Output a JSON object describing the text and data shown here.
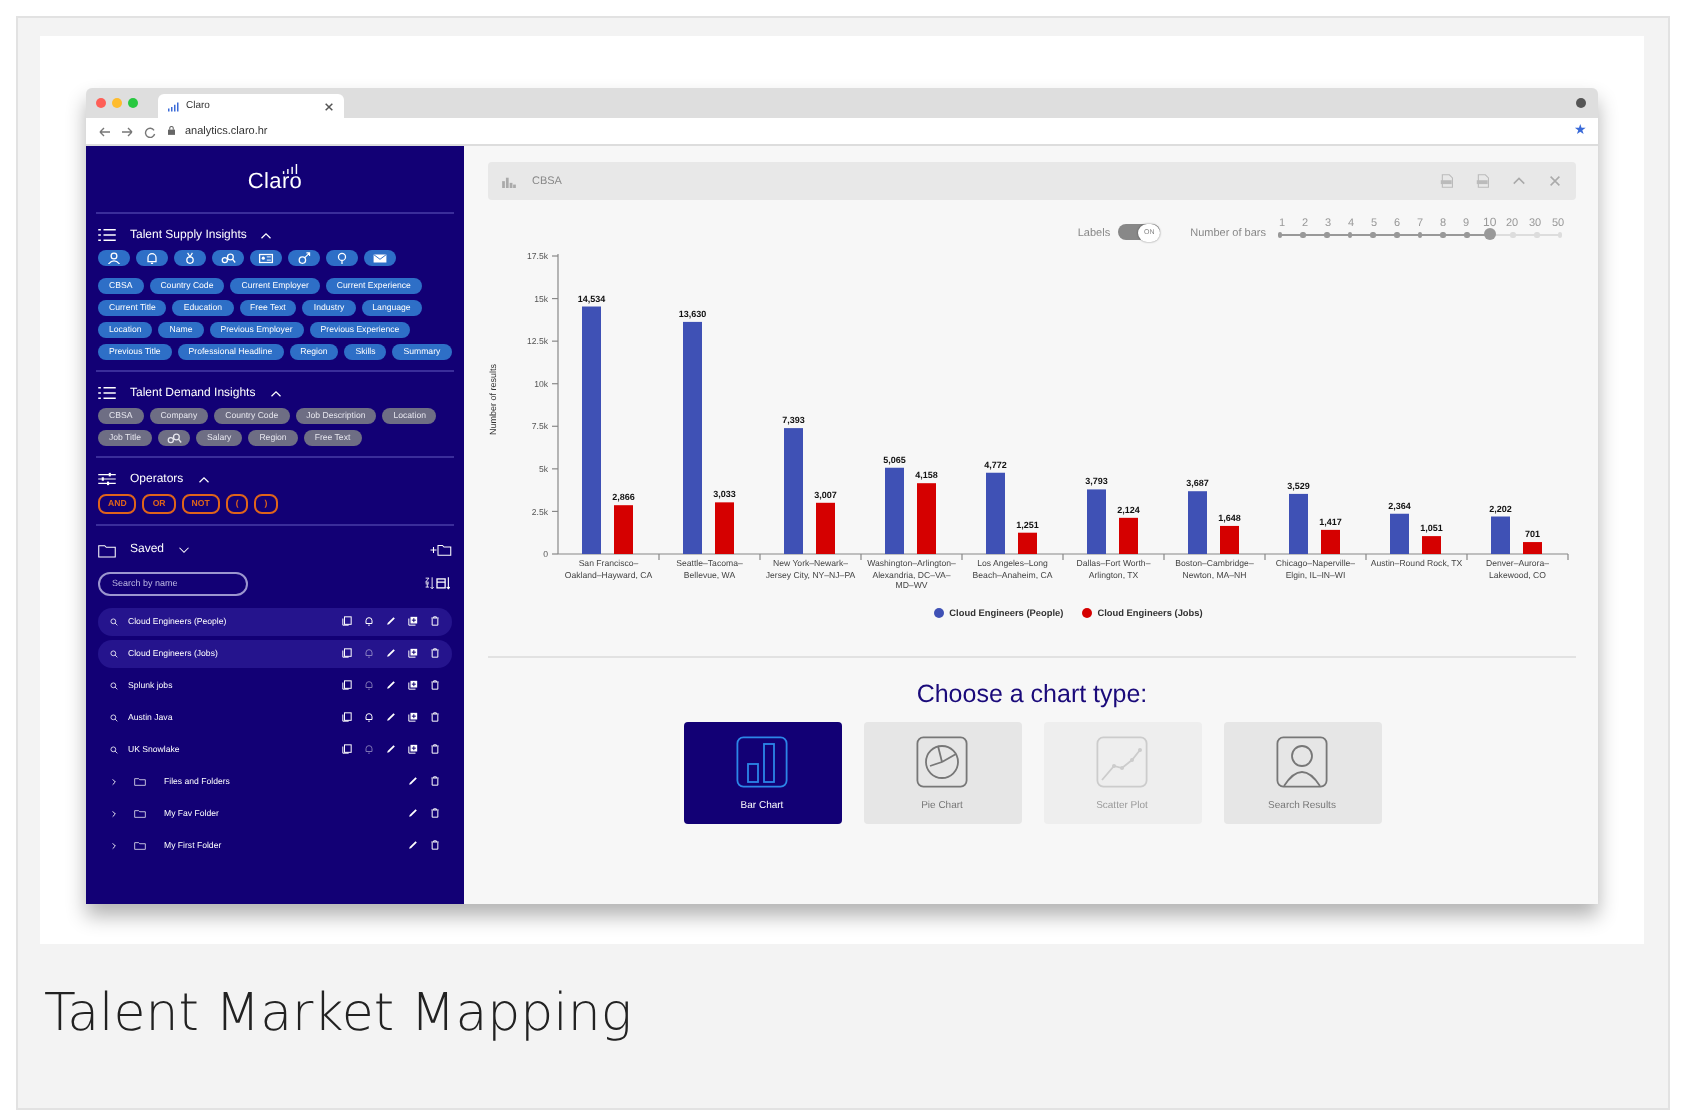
{
  "browser": {
    "tab_title": "Claro",
    "url": "analytics.claro.hr",
    "bookmark": "★"
  },
  "sidebar": {
    "logo": "Claro",
    "sections": [
      {
        "kind": "chips",
        "title": "Talent Supply Insights",
        "expanded": true,
        "disabled": false,
        "chips": [
          {
            "kind": "icon"
          },
          {
            "kind": "icon"
          },
          {
            "kind": "icon"
          },
          {
            "kind": "icon"
          },
          {
            "kind": "icon"
          },
          {
            "kind": "icon"
          },
          {
            "kind": "icon"
          },
          {
            "kind": "icon"
          },
          {
            "kind": "text",
            "label": "CBSA"
          },
          {
            "kind": "text",
            "label": "Country Code"
          },
          {
            "kind": "text",
            "label": "Current Employer"
          },
          {
            "kind": "text",
            "label": "Current Experience"
          },
          {
            "kind": "text",
            "label": "Current Title"
          },
          {
            "kind": "text",
            "label": "Education"
          },
          {
            "kind": "text",
            "label": "Free Text"
          },
          {
            "kind": "text",
            "label": "Industry"
          },
          {
            "kind": "text",
            "label": "Language"
          },
          {
            "kind": "text",
            "label": "Location"
          },
          {
            "kind": "text",
            "label": "Name"
          },
          {
            "kind": "text",
            "label": "Previous Employer"
          },
          {
            "kind": "text",
            "label": "Previous Experience"
          },
          {
            "kind": "text",
            "label": "Previous Title"
          },
          {
            "kind": "text",
            "label": "Professional Headline"
          },
          {
            "kind": "text",
            "label": "Region"
          },
          {
            "kind": "text",
            "label": "Skills"
          },
          {
            "kind": "text",
            "label": "Summary"
          }
        ]
      },
      {
        "kind": "chips",
        "title": "Talent Demand Insights",
        "expanded": true,
        "disabled": true,
        "chips": [
          {
            "kind": "text",
            "label": "CBSA"
          },
          {
            "kind": "text",
            "label": "Company"
          },
          {
            "kind": "text",
            "label": "Country Code"
          },
          {
            "kind": "text",
            "label": "Job Description"
          },
          {
            "kind": "text",
            "label": "Location"
          },
          {
            "kind": "text",
            "label": "Job Title"
          },
          {
            "kind": "icon"
          },
          {
            "kind": "text",
            "label": "Salary"
          },
          {
            "kind": "text",
            "label": "Region"
          },
          {
            "kind": "text",
            "label": "Free Text"
          }
        ]
      },
      {
        "kind": "operators",
        "title": "Operators",
        "expanded": true,
        "disabled": false,
        "chips": [
          {
            "kind": "text",
            "label": "AND"
          },
          {
            "kind": "text",
            "label": "OR"
          },
          {
            "kind": "text",
            "label": "NOT"
          },
          {
            "kind": "text",
            "label": "("
          },
          {
            "kind": "text",
            "label": ")"
          }
        ]
      }
    ],
    "saved": {
      "title": "Saved",
      "expanded": true,
      "search_placeholder": "Search by name",
      "items": [
        {
          "kind": "search",
          "label": "Cloud Engineers (People)",
          "selected": true,
          "alert": true
        },
        {
          "kind": "search",
          "label": "Cloud Engineers (Jobs)",
          "selected": true,
          "alert": false
        },
        {
          "kind": "search",
          "label": "Splunk jobs",
          "selected": false,
          "alert": false
        },
        {
          "kind": "search",
          "label": "Austin Java",
          "selected": false,
          "alert": true
        },
        {
          "kind": "search",
          "label": "UK Snowlake",
          "selected": false,
          "alert": false
        },
        {
          "kind": "folder",
          "label": "Files and Folders",
          "expanded": false
        },
        {
          "kind": "folder",
          "label": "My Fav Folder",
          "expanded": false
        },
        {
          "kind": "folder",
          "label": "My First Folder",
          "expanded": false
        }
      ]
    }
  },
  "panel": {
    "title": "CBSA",
    "labels_toggle": {
      "label": "Labels",
      "on": true,
      "text": "ON"
    },
    "bars_slider": {
      "label": "Number of bars",
      "ticks": [
        "1",
        "2",
        "3",
        "4",
        "5",
        "6",
        "7",
        "8",
        "9",
        "10",
        "20",
        "30",
        "50"
      ],
      "level": 0.75
    },
    "chart_data": {
      "type": "bar",
      "ylabel": "Number of results",
      "categories": [
        "San Francisco–Oakland–Hayward, CA",
        "Seattle–Tacoma–Bellevue, WA",
        "New York–Newark–Jersey City, NY–NJ–PA",
        "Washington–Arlington–Alexandria, DC–VA–MD–WV",
        "Los Angeles–Long Beach–Anaheim, CA",
        "Dallas–Fort Worth–Arlington, TX",
        "Boston–Cambridge–Newton, MA–NH",
        "Chicago–Naperville–Elgin, IL–IN–WI",
        "Austin–Round Rock, TX",
        "Denver–Aurora–Lakewood, CO"
      ],
      "series": [
        {
          "name": "Cloud Engineers (People)",
          "color": "#3f51b5",
          "values": [
            14534,
            13630,
            7393,
            5065,
            4772,
            3793,
            3687,
            3529,
            2364,
            2202
          ],
          "value_labels": [
            "14,534",
            "13,630",
            "7,393",
            "5,065",
            "4,772",
            "3,793",
            "3,687",
            "3,529",
            "2,364",
            "2,202"
          ]
        },
        {
          "name": "Cloud Engineers (Jobs)",
          "color": "#d50000",
          "values": [
            2866,
            3033,
            3007,
            4158,
            1251,
            2124,
            1648,
            1417,
            1051,
            701
          ],
          "value_labels": [
            "2,866",
            "3,033",
            "3,007",
            "4,158",
            "1,251",
            "2,124",
            "1,648",
            "1,417",
            "1,051",
            "701"
          ]
        }
      ],
      "legend": true,
      "ylim": [
        0,
        17500
      ],
      "yticks": [
        {
          "value": 0,
          "label": "0"
        },
        {
          "value": 2500,
          "label": "2.5k"
        },
        {
          "value": 5000,
          "label": "5k"
        },
        {
          "value": 7500,
          "label": "7.5k"
        },
        {
          "value": 10000,
          "label": "10k"
        },
        {
          "value": 12500,
          "label": "12.5k"
        },
        {
          "value": 15000,
          "label": "15k"
        },
        {
          "value": 17500,
          "label": "17.5k"
        }
      ],
      "data_labels": true
    },
    "chart_picker": {
      "heading": "Choose a chart type:",
      "options": [
        {
          "label": "Bar Chart",
          "selected": true,
          "disabled": false
        },
        {
          "label": "Pie Chart",
          "selected": false,
          "disabled": false
        },
        {
          "label": "Scatter Plot",
          "selected": false,
          "disabled": true
        },
        {
          "label": "Search Results",
          "selected": false,
          "disabled": false
        }
      ]
    }
  },
  "caption": "Talent Market Mapping"
}
